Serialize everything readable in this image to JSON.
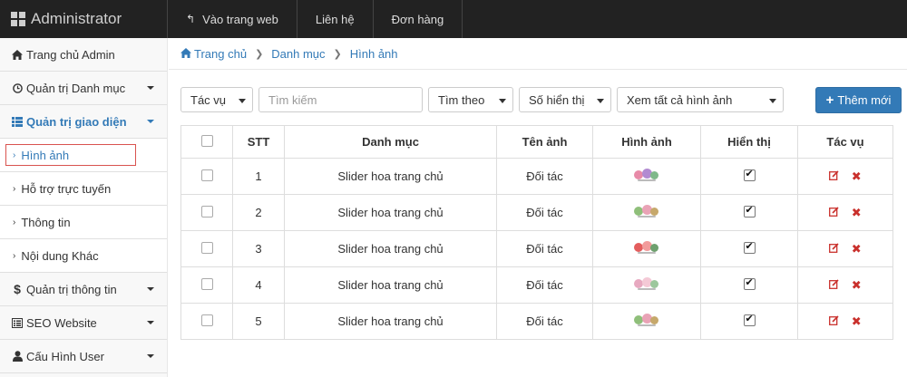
{
  "topbar": {
    "brand": "Administrator",
    "nav": [
      {
        "label": "Vào trang web"
      },
      {
        "label": "Liên hệ"
      },
      {
        "label": "Đơn hàng"
      }
    ]
  },
  "sidebar": {
    "items": [
      {
        "label": "Trang chủ Admin",
        "icon": "home-icon"
      },
      {
        "label": "Quản trị Danh mục",
        "icon": "clock-icon"
      },
      {
        "label": "Quản trị giao diện",
        "icon": "list-icon"
      },
      {
        "label": "Hình ảnh"
      },
      {
        "label": "Hỗ trợ trực tuyến"
      },
      {
        "label": "Thông tin"
      },
      {
        "label": "Nội dung Khác"
      },
      {
        "label": "Quản trị thông tin",
        "icon": "dollar-icon"
      },
      {
        "label": "SEO Website",
        "icon": "list-alt-icon"
      },
      {
        "label": "Cấu Hình User",
        "icon": "user-icon"
      }
    ]
  },
  "breadcrumb": [
    "Trang chủ",
    "Danh mục",
    "Hình ảnh"
  ],
  "toolbar": {
    "action_select": "Tác vụ",
    "search_placeholder": "Tìm kiếm",
    "search_by": "Tìm theo",
    "page_size": "Số hiển thị",
    "view_all": "Xem tất cả hình ảnh",
    "add_label": "Thêm mới"
  },
  "table": {
    "headers": [
      "STT",
      "Danh mục",
      "Tên ảnh",
      "Hình ảnh",
      "Hiển thị",
      "Tác vụ"
    ],
    "rows": [
      {
        "stt": "1",
        "category": "Slider hoa trang chủ",
        "name": "Đối tác",
        "visible": true
      },
      {
        "stt": "2",
        "category": "Slider hoa trang chủ",
        "name": "Đối tác",
        "visible": true
      },
      {
        "stt": "3",
        "category": "Slider hoa trang chủ",
        "name": "Đối tác",
        "visible": true
      },
      {
        "stt": "4",
        "category": "Slider hoa trang chủ",
        "name": "Đối tác",
        "visible": true
      },
      {
        "stt": "5",
        "category": "Slider hoa trang chủ",
        "name": "Đối tác",
        "visible": true
      }
    ]
  },
  "colors": {
    "accent": "#337ab7",
    "danger": "#c9302c",
    "topbar": "#222222"
  }
}
